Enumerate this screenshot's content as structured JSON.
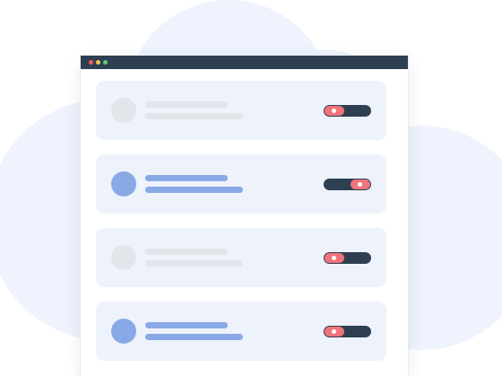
{
  "colors": {
    "cloud": "#eef3fd",
    "titlebar": "#2e3f52",
    "row_background": "#eef2fb",
    "placeholder_inactive": "#e2e5ea",
    "placeholder_active": "#89a9e6",
    "toggle_track": "#2e3f52",
    "toggle_knob": "#f0737a"
  },
  "window": {
    "controls": [
      "close-dot",
      "minimize-dot",
      "maximize-dot"
    ]
  },
  "rows": [
    {
      "active": false,
      "toggle_on": false
    },
    {
      "active": true,
      "toggle_on": true
    },
    {
      "active": false,
      "toggle_on": false
    },
    {
      "active": true,
      "toggle_on": false
    }
  ]
}
